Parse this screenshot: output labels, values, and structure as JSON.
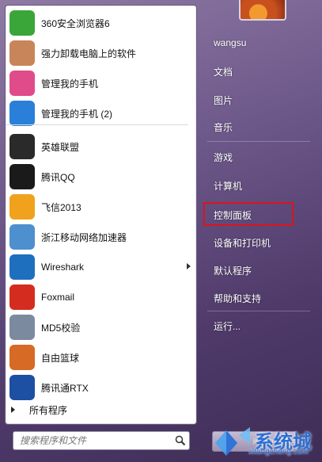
{
  "left_pane": {
    "items": [
      {
        "label": "360安全浏览器6",
        "icon": "360-browser-icon",
        "color": "#3aa63a"
      },
      {
        "label": "强力卸载电脑上的软件",
        "icon": "uninstall-box-icon",
        "color": "#c8855a"
      },
      {
        "label": "管理我的手机",
        "icon": "phone-manager-icon",
        "color": "#e04b8a"
      },
      {
        "label": "管理我的手机 (2)",
        "icon": "phone-icon",
        "color": "#2a7fd8"
      },
      {
        "label": "英雄联盟",
        "icon": "league-of-legends-icon",
        "color": "#2a2a2a"
      },
      {
        "label": "腾讯QQ",
        "icon": "qq-penguin-icon",
        "color": "#1a1a1a"
      },
      {
        "label": "飞信2013",
        "icon": "fetion-icon",
        "color": "#f0a21d"
      },
      {
        "label": "浙江移动网络加速器",
        "icon": "network-accelerator-icon",
        "color": "#4e8fcf"
      },
      {
        "label": "Wireshark",
        "icon": "wireshark-fin-icon",
        "color": "#1f6fbf"
      },
      {
        "label": "Foxmail",
        "icon": "foxmail-icon",
        "color": "#d42c1e"
      },
      {
        "label": "MD5校验",
        "icon": "md5-doc-icon",
        "color": "#7c8aa0"
      },
      {
        "label": "自由篮球",
        "icon": "basketball-icon",
        "color": "#d76a24"
      },
      {
        "label": "腾讯通RTX",
        "icon": "rtx-icon",
        "color": "#1d4fa3"
      }
    ],
    "all_programs": "所有程序",
    "search_placeholder": "搜索程序和文件"
  },
  "right_pane": {
    "user": "wangsu",
    "items": [
      "文档",
      "图片",
      "音乐",
      "游戏",
      "计算机",
      "控制面板",
      "设备和打印机",
      "默认程序",
      "帮助和支持",
      "运行..."
    ],
    "highlight_color": "#d7161c"
  },
  "watermark": {
    "text": "系统城",
    "url": "xitongcheng.com",
    "url2": "jingyan.baidu.com"
  }
}
